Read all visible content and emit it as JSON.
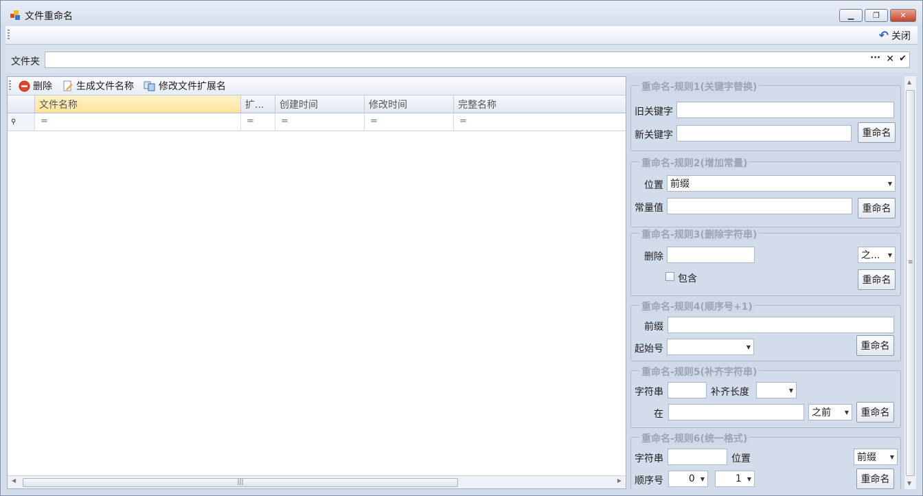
{
  "window": {
    "title": "文件重命名"
  },
  "toolbar": {
    "close_label": "关闭"
  },
  "folder": {
    "label": "文件夹",
    "value": ""
  },
  "grid_toolbar": {
    "delete": "删除",
    "generate": "生成文件名称",
    "modify_ext": "修改文件扩展名"
  },
  "grid": {
    "columns": [
      "文件名称",
      "扩...",
      "创建时间",
      "修改时间",
      "完整名称"
    ],
    "filter_symbol": "="
  },
  "rule1": {
    "title": "重命名-规则1(关键字替换)",
    "old_label": "旧关键字",
    "new_label": "新关键字",
    "button": "重命名"
  },
  "rule2": {
    "title": "重命名-规则2(增加常量)",
    "pos_label": "位置",
    "pos_value": "前缀",
    "const_label": "常量值",
    "button": "重命名"
  },
  "rule3": {
    "title": "重命名-规则3(删除字符串)",
    "del_label": "删除",
    "dir_value": "之...",
    "include_label": "包含",
    "button": "重命名"
  },
  "rule4": {
    "title": "重命名-规则4(顺序号+1)",
    "prefix_label": "前缀",
    "start_label": "起始号",
    "button": "重命名"
  },
  "rule5": {
    "title": "重命名-规则5(补齐字符串)",
    "str_label": "字符串",
    "pad_label": "补齐长度",
    "at_label": "在",
    "dir_value": "之前",
    "button": "重命名"
  },
  "rule6": {
    "title": "重命名-规则6(统一格式)",
    "str_label": "字符串",
    "pos_label": "位置",
    "pos_value": "前缀",
    "seq_label": "顺序号",
    "seq_a": "0",
    "seq_b": "1",
    "button": "重命名"
  }
}
